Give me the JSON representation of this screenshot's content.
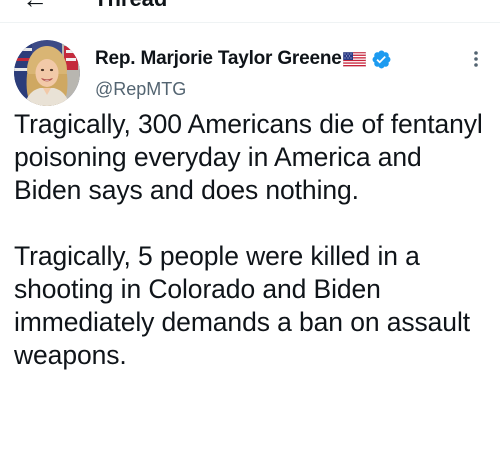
{
  "header": {
    "title": "Thread",
    "back_icon": "arrow-left-icon"
  },
  "tweet": {
    "author_name": "Rep. Marjorie Taylor Greene",
    "author_handle": "@RepMTG",
    "author_flag": "us-flag-icon",
    "verified": true,
    "verified_color": "#1d9bf0",
    "paragraphs": [
      "Tragically, 300 Americans die of fentanyl poisoning everyday in America and Biden says and does nothing.",
      "Tragically, 5 people were killed in a shooting in Colorado and Biden immediately demands a ban on assault weapons."
    ]
  },
  "colors": {
    "text": "#0f1419",
    "secondary_text": "#536471",
    "divider": "#eff3f4",
    "accent": "#1d9bf0"
  }
}
